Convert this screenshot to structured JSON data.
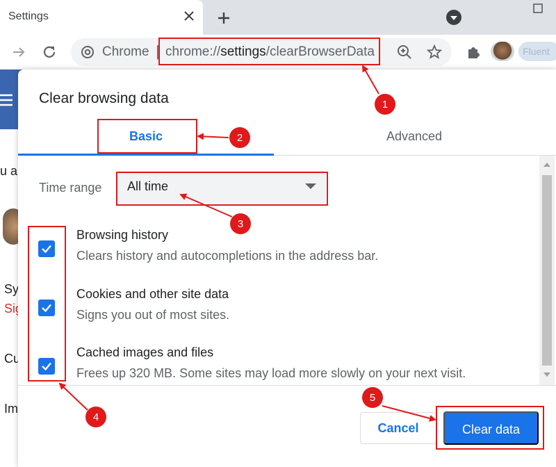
{
  "browser": {
    "tab_title": "Settings",
    "omnibox": {
      "site_label": "Chrome",
      "separator": "|",
      "url_prefix": "chrome://",
      "url_host": "settings",
      "url_path": "/clearBrowserData"
    },
    "profile_name": "Fluent"
  },
  "background_page": {
    "fragments": [
      "u a",
      "Sy",
      "Sig",
      "Cu",
      "Im"
    ]
  },
  "dialog": {
    "title": "Clear browsing data",
    "tabs": [
      {
        "label": "Basic",
        "active": true
      },
      {
        "label": "Advanced",
        "active": false
      }
    ],
    "time_range": {
      "label": "Time range",
      "value": "All time"
    },
    "options": [
      {
        "title": "Browsing history",
        "description": "Clears history and autocompletions in the address bar.",
        "checked": true
      },
      {
        "title": "Cookies and other site data",
        "description": "Signs you out of most sites.",
        "checked": true
      },
      {
        "title": "Cached images and files",
        "description": "Frees up 320 MB. Some sites may load more slowly on your next visit.",
        "checked": true
      }
    ],
    "buttons": {
      "cancel": "Cancel",
      "clear": "Clear data"
    }
  },
  "annotations": {
    "numbers": [
      "1",
      "2",
      "3",
      "4",
      "5"
    ],
    "color": "#e0191b"
  },
  "colors": {
    "accent": "#1a73e8",
    "tabstrip": "#dee1e6",
    "header": "#3a66b0"
  }
}
